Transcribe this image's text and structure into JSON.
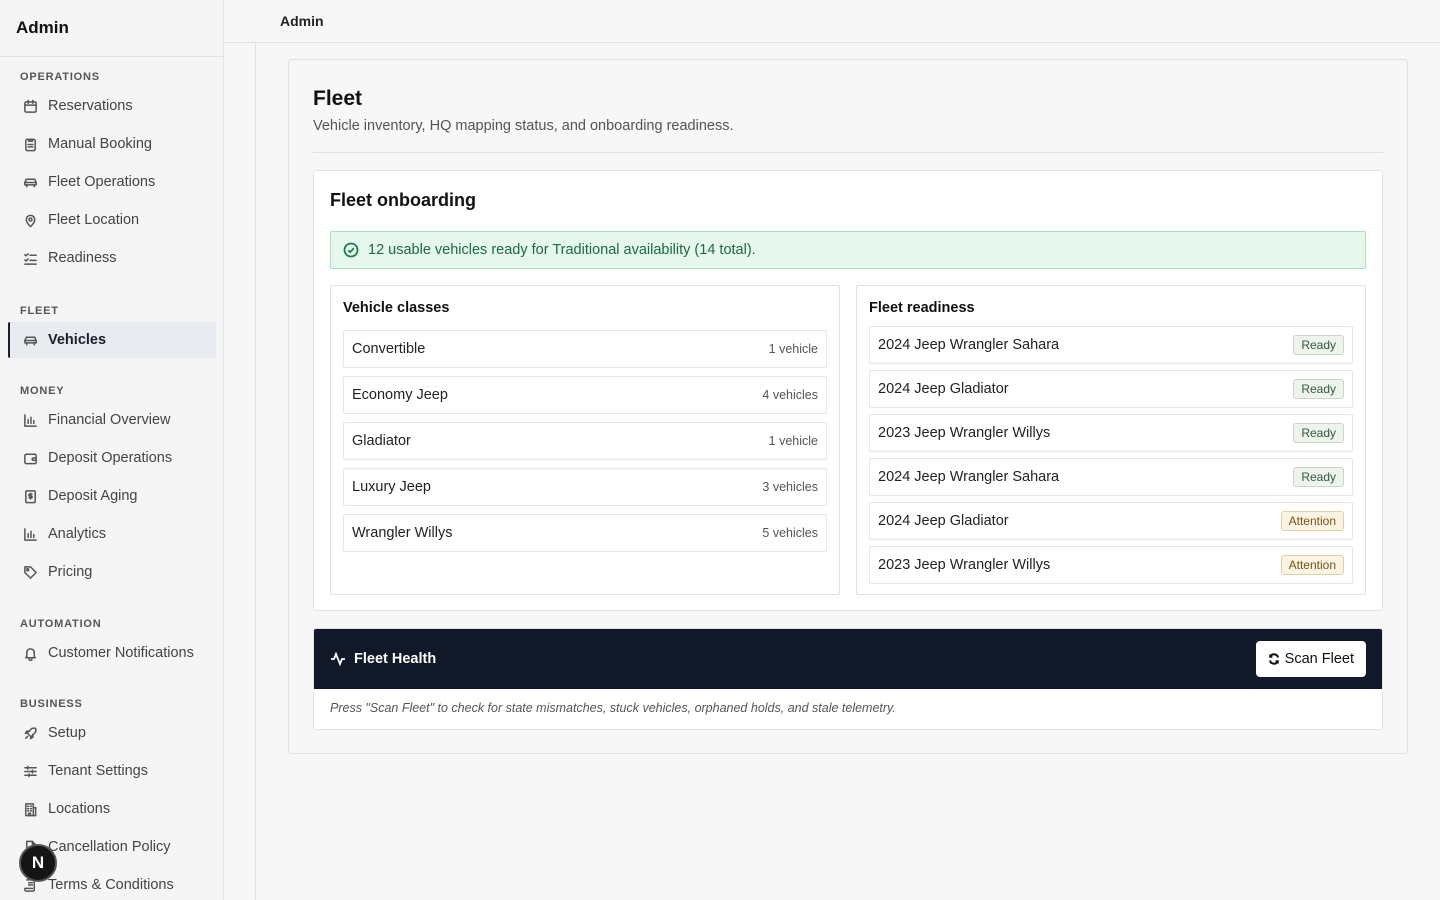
{
  "sidebar": {
    "title": "Admin",
    "sections": [
      {
        "label": "OPERATIONS",
        "items": [
          {
            "label": "Reservations",
            "icon": "calendar-icon"
          },
          {
            "label": "Manual Booking",
            "icon": "clipboard-icon"
          },
          {
            "label": "Fleet Operations",
            "icon": "car-icon"
          },
          {
            "label": "Fleet Location",
            "icon": "map-pin-icon"
          },
          {
            "label": "Readiness",
            "icon": "checklist-icon"
          }
        ]
      },
      {
        "label": "FLEET",
        "items": [
          {
            "label": "Vehicles",
            "icon": "car-icon",
            "active": true
          }
        ]
      },
      {
        "label": "MONEY",
        "items": [
          {
            "label": "Financial Overview",
            "icon": "bar-chart-icon"
          },
          {
            "label": "Deposit Operations",
            "icon": "wallet-icon"
          },
          {
            "label": "Deposit Aging",
            "icon": "dollar-receipt-icon"
          },
          {
            "label": "Analytics",
            "icon": "bar-chart-icon"
          },
          {
            "label": "Pricing",
            "icon": "tag-icon"
          }
        ]
      },
      {
        "label": "AUTOMATION",
        "items": [
          {
            "label": "Customer Notifications",
            "icon": "bell-icon"
          }
        ]
      },
      {
        "label": "BUSINESS",
        "items": [
          {
            "label": "Setup",
            "icon": "rocket-icon"
          },
          {
            "label": "Tenant Settings",
            "icon": "sliders-icon"
          },
          {
            "label": "Locations",
            "icon": "building-icon"
          },
          {
            "label": "Cancellation Policy",
            "icon": "document-icon"
          },
          {
            "label": "Terms & Conditions",
            "icon": "scroll-icon"
          }
        ]
      }
    ],
    "badge_letter": "N"
  },
  "topbar": {
    "title": "Admin"
  },
  "page": {
    "title": "Fleet",
    "subtitle": "Vehicle inventory, HQ mapping status, and onboarding readiness."
  },
  "onboarding": {
    "title": "Fleet onboarding",
    "alert": "12 usable vehicles ready for Traditional availability (14 total).",
    "classes_title": "Vehicle classes",
    "classes": [
      {
        "name": "Convertible",
        "count": "1 vehicle"
      },
      {
        "name": "Economy Jeep",
        "count": "4 vehicles"
      },
      {
        "name": "Gladiator",
        "count": "1 vehicle"
      },
      {
        "name": "Luxury Jeep",
        "count": "3 vehicles"
      },
      {
        "name": "Wrangler Willys",
        "count": "5 vehicles"
      }
    ],
    "readiness_title": "Fleet readiness",
    "readiness": [
      {
        "name": "2024 Jeep Wrangler Sahara",
        "status": "Ready",
        "kind": "ready"
      },
      {
        "name": "2024 Jeep Gladiator",
        "status": "Ready",
        "kind": "ready"
      },
      {
        "name": "2023 Jeep Wrangler Willys",
        "status": "Ready",
        "kind": "ready"
      },
      {
        "name": "2024 Jeep Wrangler Sahara",
        "status": "Ready",
        "kind": "ready"
      },
      {
        "name": "2024 Jeep Gladiator",
        "status": "Attention",
        "kind": "attention"
      },
      {
        "name": "2023 Jeep Wrangler Willys",
        "status": "Attention",
        "kind": "attention"
      }
    ]
  },
  "health": {
    "title": "Fleet Health",
    "scan_label": "Scan Fleet",
    "note": "Press \"Scan Fleet\" to check for state mismatches, stuck vehicles, orphaned holds, and stale telemetry."
  }
}
